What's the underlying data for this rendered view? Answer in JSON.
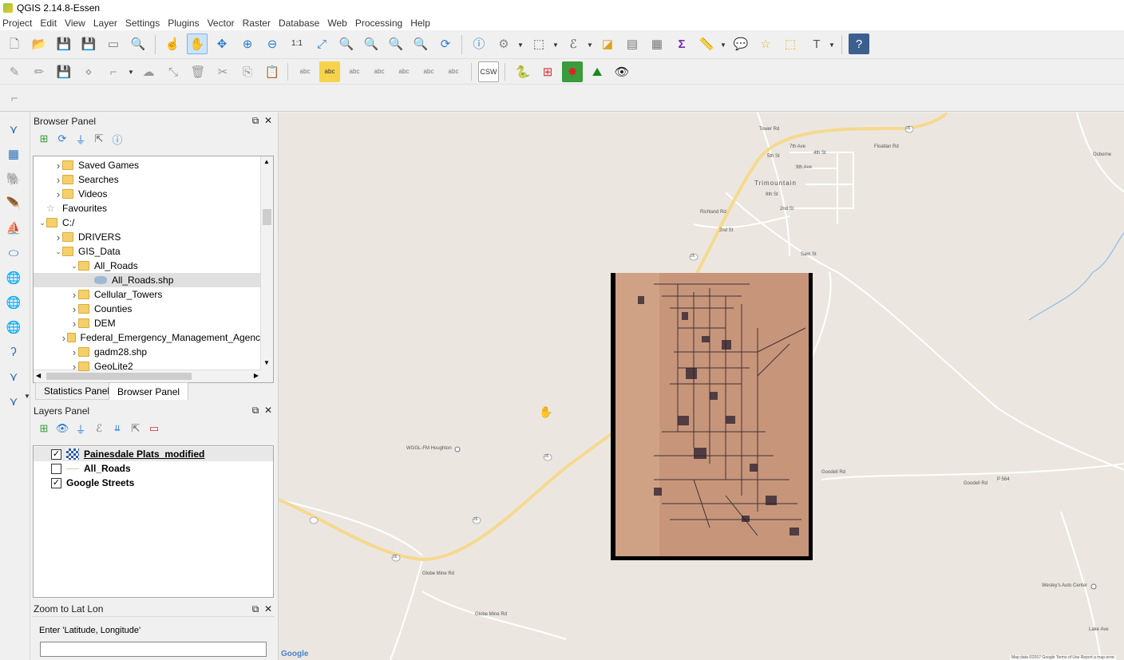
{
  "window": {
    "title": "QGIS 2.14.8-Essen"
  },
  "menu": [
    "Project",
    "Edit",
    "View",
    "Layer",
    "Settings",
    "Plugins",
    "Vector",
    "Raster",
    "Database",
    "Web",
    "Processing",
    "Help"
  ],
  "browser_panel": {
    "title": "Browser Panel",
    "items": [
      {
        "label": "Saved Games",
        "indent": 1,
        "expanded": false
      },
      {
        "label": "Searches",
        "indent": 1,
        "expanded": false
      },
      {
        "label": "Videos",
        "indent": 1,
        "expanded": false
      },
      {
        "label": "Favourites",
        "indent": 0,
        "expanded": null
      },
      {
        "label": "C:/",
        "indent": 0,
        "expanded": true
      },
      {
        "label": "DRIVERS",
        "indent": 1,
        "expanded": false
      },
      {
        "label": "GIS_Data",
        "indent": 1,
        "expanded": true
      },
      {
        "label": "All_Roads",
        "indent": 2,
        "expanded": true
      },
      {
        "label": "All_Roads.shp",
        "indent": 3,
        "expanded": null,
        "selected": true
      },
      {
        "label": "Cellular_Towers",
        "indent": 2,
        "expanded": false
      },
      {
        "label": "Counties",
        "indent": 2,
        "expanded": false
      },
      {
        "label": "DEM",
        "indent": 2,
        "expanded": false
      },
      {
        "label": "Federal_Emergency_Management_Agenc",
        "indent": 2,
        "expanded": false
      },
      {
        "label": "gadm28.shp",
        "indent": 2,
        "expanded": false
      },
      {
        "label": "GeoLite2",
        "indent": 2,
        "expanded": false
      }
    ]
  },
  "tabs": {
    "statistics": "Statistics Panel",
    "browser": "Browser Panel"
  },
  "layers_panel": {
    "title": "Layers Panel",
    "layers": [
      {
        "name": "Painesdale Plats_modified",
        "checked": true,
        "bold": true,
        "underline": true
      },
      {
        "name": "All_Roads",
        "checked": false,
        "bold": true
      },
      {
        "name": "Google Streets",
        "checked": true,
        "bold": true
      }
    ]
  },
  "zoom_panel": {
    "title": "Zoom to Lat Lon",
    "label": "Enter 'Latitude, Longitude'",
    "value": ""
  },
  "map": {
    "labels": {
      "trimountain": "Trimountain",
      "wggl": "WGGL-FM Houghton",
      "wesley": "Wesley's Auto Center",
      "google": "Google",
      "footer": "Map data ©2017 Google   Terms of Use   Report a map error",
      "r26a": "26",
      "r26b": "26",
      "r26c": "26",
      "r26d": "26",
      "r26e": "26",
      "fifth": "5th St",
      "fourth": "4th St",
      "eighth": "8th St",
      "ninth": "9th Ave",
      "tenth": "7th Ave",
      "second": "2nd St",
      "seconda": "2nd St",
      "third": "3rd St",
      "h2nd": "2nd Ave",
      "rich": "Richland Rd",
      "flagg": "Floatlan Rd",
      "towar": "Tower Rd",
      "globe": "Globe Mine Rd",
      "globe2": "Globe Mine Rd",
      "goodell": "Goodell Rd",
      "goodell2": "Goodell Rd",
      "p564": "P 564",
      "sam": "Sam St",
      "lake": "Lake Ave",
      "okkay": "Osborne",
      "pain": "Painesdale Rd",
      "chev": "Chelonia Dr"
    },
    "colors": {
      "background": "#ebe7e0",
      "highway": "#f6d98f",
      "road": "#ffffff",
      "water": "#9cc4e6"
    }
  }
}
